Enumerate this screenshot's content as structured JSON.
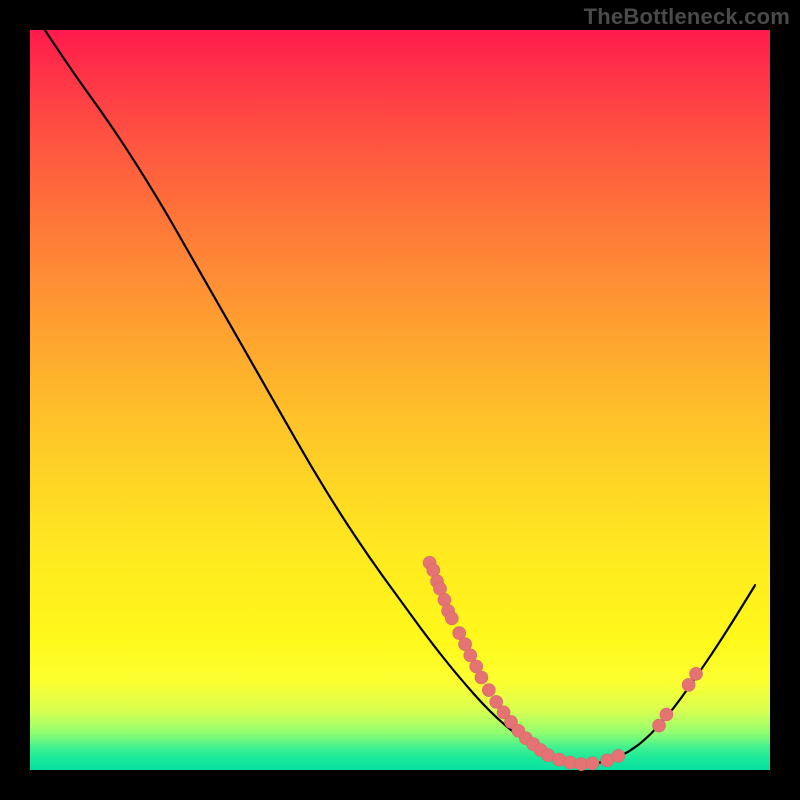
{
  "watermark": "TheBottleneck.com",
  "colors": {
    "curve_stroke": "#000000",
    "point_fill": "#e57373",
    "point_stroke": "#d46a6a"
  },
  "chart_data": {
    "type": "line",
    "title": "",
    "xlabel": "",
    "ylabel": "",
    "xlim": [
      0,
      100
    ],
    "ylim": [
      0,
      100
    ],
    "curve": [
      {
        "x": 2.0,
        "y": 100.0
      },
      {
        "x": 6.0,
        "y": 94.0
      },
      {
        "x": 10.0,
        "y": 88.5
      },
      {
        "x": 14.0,
        "y": 82.5
      },
      {
        "x": 18.0,
        "y": 76.0
      },
      {
        "x": 22.0,
        "y": 69.0
      },
      {
        "x": 26.0,
        "y": 62.0
      },
      {
        "x": 30.0,
        "y": 55.0
      },
      {
        "x": 34.0,
        "y": 48.0
      },
      {
        "x": 38.0,
        "y": 41.0
      },
      {
        "x": 42.0,
        "y": 34.5
      },
      {
        "x": 46.0,
        "y": 28.5
      },
      {
        "x": 50.0,
        "y": 23.0
      },
      {
        "x": 54.0,
        "y": 17.5
      },
      {
        "x": 58.0,
        "y": 12.5
      },
      {
        "x": 62.0,
        "y": 8.0
      },
      {
        "x": 66.0,
        "y": 4.5
      },
      {
        "x": 70.0,
        "y": 2.0
      },
      {
        "x": 74.0,
        "y": 0.8
      },
      {
        "x": 78.0,
        "y": 1.0
      },
      {
        "x": 82.0,
        "y": 3.0
      },
      {
        "x": 86.0,
        "y": 7.0
      },
      {
        "x": 90.0,
        "y": 12.5
      },
      {
        "x": 94.0,
        "y": 18.5
      },
      {
        "x": 98.0,
        "y": 25.0
      }
    ],
    "series": [
      {
        "name": "markers",
        "type": "scatter",
        "points": [
          {
            "x": 54.0,
            "y": 28.0
          },
          {
            "x": 54.5,
            "y": 27.0
          },
          {
            "x": 55.0,
            "y": 25.5
          },
          {
            "x": 55.4,
            "y": 24.5
          },
          {
            "x": 56.0,
            "y": 23.0
          },
          {
            "x": 56.5,
            "y": 21.5
          },
          {
            "x": 57.0,
            "y": 20.5
          },
          {
            "x": 58.0,
            "y": 18.5
          },
          {
            "x": 58.8,
            "y": 17.0
          },
          {
            "x": 59.5,
            "y": 15.5
          },
          {
            "x": 60.3,
            "y": 14.0
          },
          {
            "x": 61.0,
            "y": 12.5
          },
          {
            "x": 62.0,
            "y": 10.8
          },
          {
            "x": 63.0,
            "y": 9.2
          },
          {
            "x": 64.0,
            "y": 7.8
          },
          {
            "x": 65.0,
            "y": 6.5
          },
          {
            "x": 66.0,
            "y": 5.3
          },
          {
            "x": 67.0,
            "y": 4.3
          },
          {
            "x": 68.0,
            "y": 3.5
          },
          {
            "x": 69.0,
            "y": 2.7
          },
          {
            "x": 70.0,
            "y": 2.0
          },
          {
            "x": 71.5,
            "y": 1.4
          },
          {
            "x": 73.0,
            "y": 1.0
          },
          {
            "x": 74.5,
            "y": 0.8
          },
          {
            "x": 76.0,
            "y": 0.9
          },
          {
            "x": 78.0,
            "y": 1.3
          },
          {
            "x": 79.5,
            "y": 1.9
          },
          {
            "x": 85.0,
            "y": 6.0
          },
          {
            "x": 86.0,
            "y": 7.5
          },
          {
            "x": 89.0,
            "y": 11.5
          },
          {
            "x": 90.0,
            "y": 13.0
          }
        ]
      }
    ]
  }
}
